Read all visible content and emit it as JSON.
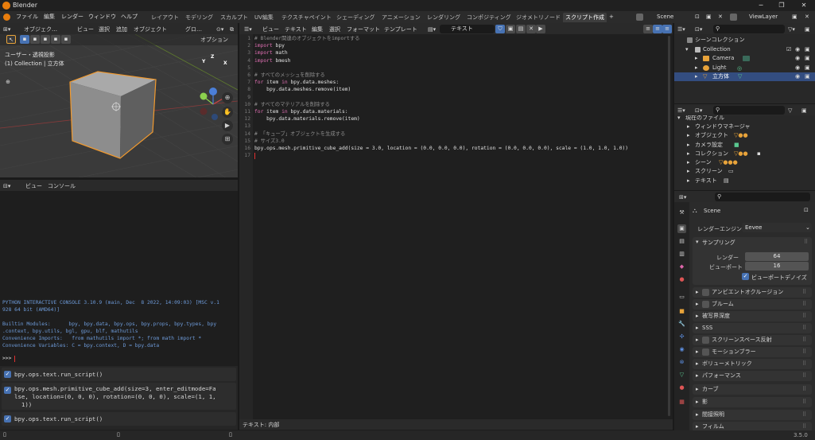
{
  "window": {
    "title": "Blender",
    "version": "3.5.0"
  },
  "menus": [
    "ファイル",
    "編集",
    "レンダー",
    "ウィンドウ",
    "ヘルプ"
  ],
  "workspaces": [
    "レイアウト",
    "モデリング",
    "スカルプト",
    "UV編集",
    "テクスチャペイント",
    "シェーディング",
    "アニメーション",
    "レンダリング",
    "コンポジティング",
    "ジオメトリノード",
    "スクリプト作成"
  ],
  "active_workspace": "スクリプト作成",
  "scene": "Scene",
  "view_layer": "ViewLayer",
  "viewport": {
    "header_items": [
      "オブジェク…",
      "ビュー",
      "選択",
      "追加",
      "オブジェクト",
      "グロ…"
    ],
    "options": "オプション",
    "overlay_title": "ユーザー・透視投影",
    "overlay_sub": "(1) Collection | 立方体",
    "gizmo": {
      "x": "X",
      "y": "Y",
      "z": "Z"
    }
  },
  "console": {
    "header_items": [
      "ビュー",
      "コンソール"
    ],
    "lines": [
      "PYTHON INTERACTIVE CONSOLE 3.10.9 (main, Dec  8 2022, 14:09:03) [MSC v.1",
      "928 64 bit (AMD64)]",
      "",
      "Builtin Modules:      bpy, bpy.data, bpy.ops, bpy.props, bpy.types, bpy",
      ".context, bpy.utils, bgl, gpu, blf, mathutils",
      "Convenience Imports:   from mathutils import *; from math import *",
      "Convenience Variables: C = bpy.context, D = bpy.data"
    ],
    "prompt": ">>> "
  },
  "info_log": [
    "bpy.ops.text.run_script()",
    "bpy.ops.mesh.primitive_cube_add(size=3, enter_editmode=Fa\nlse, location=(0, 0, 0), rotation=(0, 0, 0), scale=(1, 1,\n  1))",
    "bpy.ops.text.run_script()"
  ],
  "text_editor": {
    "header_items": [
      "ビュー",
      "テキスト",
      "編集",
      "選択",
      "フォーマット",
      "テンプレート"
    ],
    "text_name": "テキスト",
    "footer": "テキスト: 内部",
    "line_numbers": [
      "1",
      "2",
      "3",
      "4",
      "5",
      "6",
      "7",
      "8",
      "9",
      "10",
      "11",
      "12",
      "13",
      "14",
      "15",
      "16",
      "17"
    ],
    "code": {
      "l1": "# Blender関連のオブジェクトをimportする",
      "l2a": "import",
      "l2b": " bpy",
      "l3a": "import",
      "l3b": " math",
      "l4a": "import",
      "l4b": " bmesh",
      "l6": "# すべてのメッシュを削除する",
      "l7a": "for",
      "l7b": " item ",
      "l7c": "in",
      "l7d": " bpy.data.meshes:",
      "l8": "    bpy.data.meshes.remove(item)",
      "l10": "# すべてのマテリアルを削除する",
      "l11a": "for",
      "l11b": " item ",
      "l11c": "in",
      "l11d": " bpy.data.materials:",
      "l12": "    bpy.data.materials.remove(item)",
      "l14": "# 「キューブ」オブジェクトを生成する",
      "l15": "# サイズ3.0",
      "l16": "bpy.ops.mesh.primitive_cube_add(size = 3.0, location = (0.0, 0.0, 0.0), rotation = (0.0, 0.0, 0.0), scale = (1.0, 1.0, 1.0))"
    }
  },
  "outliner": {
    "scene_collection": "シーンコレクション",
    "collection": "Collection",
    "items": [
      "Camera",
      "Light",
      "立方体"
    ]
  },
  "file_browser": {
    "root": "現在のファイル",
    "items": [
      "ウィンドウマネージャ",
      "オブジェクト",
      "カメラ設定",
      "コレクション",
      "シーン",
      "スクリーン",
      "テキスト"
    ]
  },
  "properties": {
    "scene": "Scene",
    "engine_label": "レンダーエンジン",
    "engine": "Eevee",
    "sampling": "サンプリング",
    "render_label": "レンダー",
    "render_value": "64",
    "viewport_label": "ビューポート",
    "viewport_value": "16",
    "denoise": "ビューポートデノイズ",
    "panels": [
      "アンビエントオクルージョン",
      "ブルーム",
      "被写界深度",
      "SSS",
      "スクリーンスペース反射",
      "モーションブラー",
      "ボリューメトリック",
      "パフォーマンス",
      "カーブ",
      "影",
      "間接照明",
      "フィルム"
    ]
  },
  "colors": {
    "accent": "#4772b3",
    "selected": "#334d80",
    "keyword": "#e06fb3",
    "comment": "#8f8f8f",
    "cube_outline": "#f29a2e"
  }
}
